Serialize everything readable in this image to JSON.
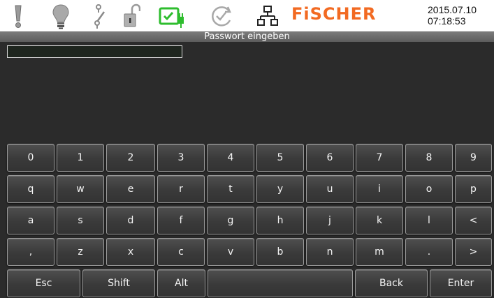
{
  "header": {
    "icons": [
      "alert-icon",
      "lightbulb-icon",
      "switch-icon",
      "unlock-icon",
      "battery-plug-icon",
      "sync-check-icon",
      "network-icon"
    ],
    "brand": "FiSCHER",
    "brand_color": "#f26a22",
    "date": "2015.07.10",
    "time": "07:18:53"
  },
  "title": "Passwort eingeben",
  "password": {
    "value": "",
    "placeholder": ""
  },
  "keyboard": {
    "rows": [
      [
        "0",
        "1",
        "2",
        "3",
        "4",
        "5",
        "6",
        "7",
        "8",
        "9"
      ],
      [
        "q",
        "w",
        "e",
        "r",
        "t",
        "y",
        "u",
        "i",
        "o",
        "p"
      ],
      [
        "a",
        "s",
        "d",
        "f",
        "g",
        "h",
        "j",
        "k",
        "l",
        "<"
      ],
      [
        ",",
        "z",
        "x",
        "c",
        "v",
        "b",
        "n",
        "m",
        ".",
        ">"
      ]
    ],
    "bottom_row": {
      "esc": "Esc",
      "shift": "Shift",
      "alt": "Alt",
      "space": "",
      "back": "Back",
      "enter": "Enter"
    }
  }
}
